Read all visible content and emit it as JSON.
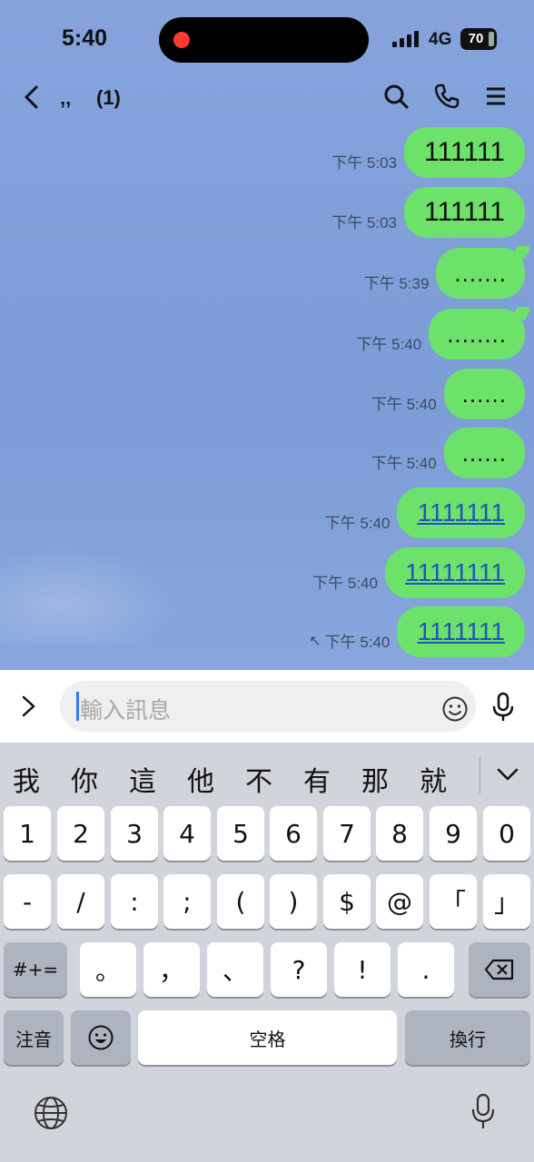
{
  "status": {
    "time": "5:40",
    "network": "4G",
    "battery": "70"
  },
  "header": {
    "chat_name": "‚‚",
    "member_count": "(1)"
  },
  "messages": [
    {
      "time": "下午 5:03",
      "text": "111111",
      "kind": "normal"
    },
    {
      "time": "下午 5:03",
      "text": "111111",
      "kind": "normal"
    },
    {
      "time": "下午 5:39",
      "text": ".......",
      "kind": "dots"
    },
    {
      "time": "下午 5:40",
      "text": "........",
      "kind": "dots"
    },
    {
      "time": "下午 5:40",
      "text": "......",
      "kind": "dots"
    },
    {
      "time": "下午 5:40",
      "text": "......",
      "kind": "dots"
    },
    {
      "time": "下午 5:40",
      "text": "1111111",
      "kind": "link"
    },
    {
      "time": "下午 5:40",
      "text": "11111111",
      "kind": "link"
    },
    {
      "time": "下午 5:40",
      "text": "1111111",
      "kind": "link",
      "read_arrow": "↖"
    }
  ],
  "input": {
    "placeholder": "輸入訊息"
  },
  "keyboard": {
    "candidates": [
      "我",
      "你",
      "這",
      "他",
      "不",
      "有",
      "那",
      "就"
    ],
    "row1": [
      "1",
      "2",
      "3",
      "4",
      "5",
      "6",
      "7",
      "8",
      "9",
      "0"
    ],
    "row2": [
      "-",
      "/",
      ":",
      ";",
      "(",
      ")",
      "$",
      "@",
      "「",
      "」"
    ],
    "row3_left": "#+=",
    "row3": [
      "。",
      "，",
      "、",
      "?",
      "!",
      "."
    ],
    "bottom": {
      "zhuyin": "注音",
      "space": "空格",
      "return": "換行"
    }
  },
  "colors": {
    "bubble": "#6de26b",
    "link": "#1f56b8",
    "chat_bg": "#7f9fd8"
  }
}
